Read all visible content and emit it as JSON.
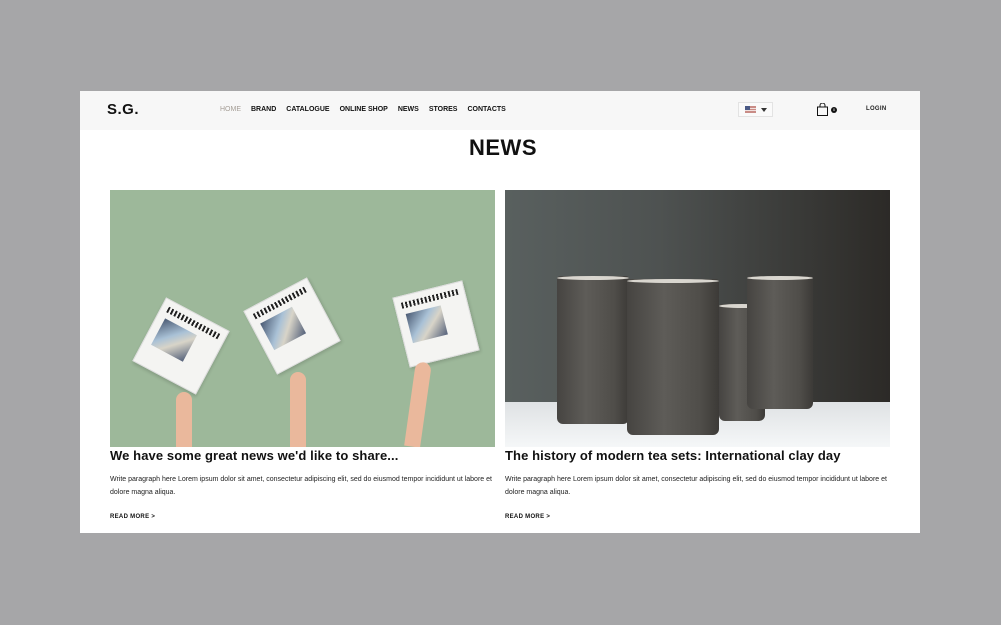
{
  "header": {
    "logo": "S.G.",
    "nav": [
      {
        "label": "HOME",
        "active": true
      },
      {
        "label": "BRAND",
        "active": false
      },
      {
        "label": "CATALOGUE",
        "active": false
      },
      {
        "label": "ONLINE SHOP",
        "active": false
      },
      {
        "label": "NEWS",
        "active": false
      },
      {
        "label": "STORES",
        "active": false
      },
      {
        "label": "CONTACTS",
        "active": false
      }
    ],
    "language": {
      "selected": "US flag",
      "icon": "us-flag-icon"
    },
    "cart": {
      "icon": "shopping-bag-icon",
      "count": "0"
    },
    "login_label": "LOGIN"
  },
  "main": {
    "title": "NEWS",
    "articles": [
      {
        "image_alt": "Three hands holding up Business Review newspapers against a green wall",
        "title": "We have some great news we'd like to share...",
        "text": "Write paragraph here Lorem ipsum dolor sit amet, consectetur adipiscing elit, sed do eiusmod tempor incididunt ut labore et dolore magna aliqua.",
        "read_more": "READ MORE >"
      },
      {
        "image_alt": "Four dark grey clay pitchers on a white table",
        "title": "The history of modern tea sets: International clay day",
        "text": "Write paragraph here Lorem ipsum dolor sit amet, consectetur adipiscing elit, sed do eiusmod tempor incididunt ut labore et dolore magna aliqua.",
        "read_more": "READ MORE >"
      }
    ]
  },
  "colors": {
    "backdrop": "#a6a6a8",
    "header_bg": "#f7f7f7",
    "nav_active": "#a59e96",
    "text": "#111111",
    "news_image_green": "#9db89a"
  }
}
